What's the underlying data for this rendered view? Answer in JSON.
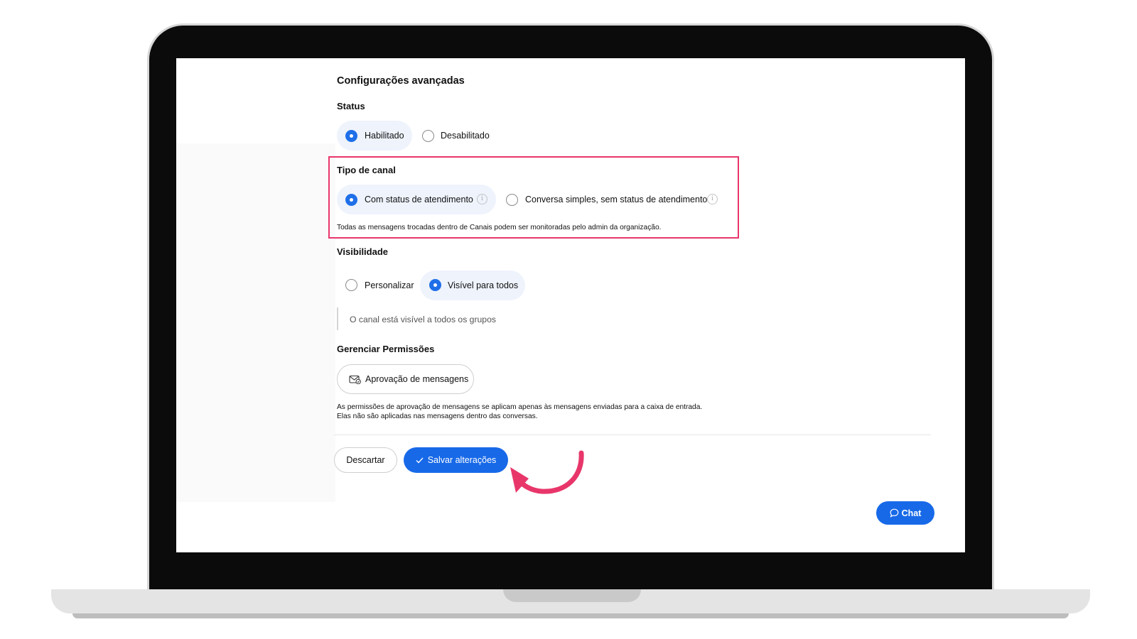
{
  "form": {
    "title": "Configurações avançadas",
    "status": {
      "label": "Status",
      "options": [
        "Habilitado",
        "Desabilitado"
      ],
      "selected": "Habilitado"
    },
    "channel_type": {
      "label": "Tipo de canal",
      "options": [
        "Com status de atendimento",
        "Conversa simples, sem status de atendimento"
      ],
      "selected": "Com status de atendimento",
      "note": "Todas as mensagens trocadas dentro de Canais podem ser monitoradas pelo admin da organização."
    },
    "visibility": {
      "label": "Visibilidade",
      "options": [
        "Personalizar",
        "Visível para todos"
      ],
      "selected": "Visível para todos",
      "description": "O canal está visível a todos os grupos"
    },
    "permissions": {
      "label": "Gerenciar Permissões",
      "button_label": "Aprovação de mensagens",
      "note_line1": "As permissões de aprovação de mensagens se aplicam apenas às mensagens enviadas para a caixa de entrada.",
      "note_line2": "Elas não são aplicadas nas mensagens dentro das conversas."
    }
  },
  "actions": {
    "discard_label": "Descartar",
    "save_label": "Salvar alterações"
  },
  "chat": {
    "label": "Chat"
  },
  "colors": {
    "primary": "#1769e8",
    "highlight": "#e8366b"
  },
  "icons": {
    "radio_selected": "radio-selected-icon",
    "info": "info-icon",
    "envelope": "envelope-check-icon",
    "check": "check-icon",
    "chat_bubble": "chat-bubble-icon",
    "arrow": "curved-arrow-icon"
  }
}
